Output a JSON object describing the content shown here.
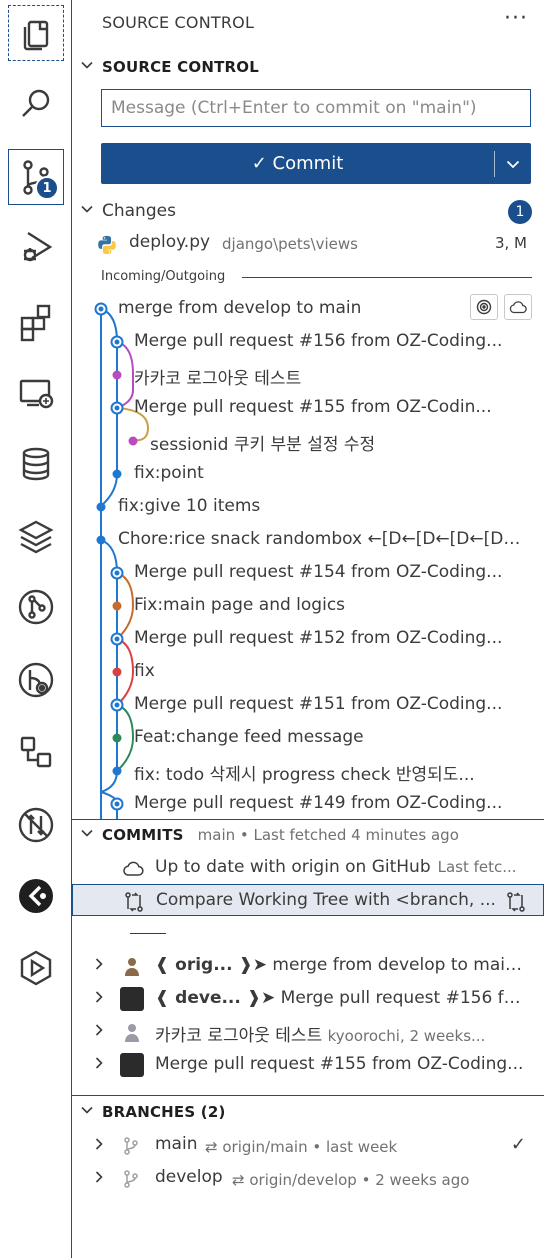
{
  "sidebar": {
    "title": "SOURCE CONTROL",
    "more": "···"
  },
  "activity": {
    "items": [
      {
        "icon": "explorer-icon"
      },
      {
        "icon": "search-icon"
      },
      {
        "icon": "source-control-icon",
        "badge": "1"
      },
      {
        "icon": "run-debug-icon"
      },
      {
        "icon": "extensions-icon"
      },
      {
        "icon": "remote-explorer-icon"
      },
      {
        "icon": "database-icon"
      },
      {
        "icon": "layers-icon"
      },
      {
        "icon": "git-graph-icon"
      },
      {
        "icon": "git-lens-icon"
      },
      {
        "icon": "workflow-icon"
      },
      {
        "icon": "no-sync-icon"
      },
      {
        "icon": "live-share-icon"
      },
      {
        "icon": "container-icon"
      }
    ]
  },
  "scm": {
    "section_title": "SOURCE CONTROL",
    "message_placeholder": "Message (Ctrl+Enter to commit on \"main\")",
    "commit_label": "✓ Commit",
    "changes_label": "Changes",
    "changes_count": "1",
    "file": {
      "name": "deploy.py",
      "dir": "django\\pets\\views",
      "status": "3, M"
    },
    "incoming_outgoing_label": "Incoming/Outgoing",
    "graph": [
      {
        "text": "merge from develop to main",
        "color": "#1f77d0",
        "lane": 0
      },
      {
        "text": "Merge pull request #156 from OZ-Coding...",
        "color": "#1f77d0",
        "lane": 1
      },
      {
        "text": "카카코 로그아웃 테스트",
        "color": "#b84cbf",
        "lane": 1
      },
      {
        "text": "Merge pull request #155 from OZ-Codin...",
        "color": "#1f77d0",
        "lane": 1
      },
      {
        "text": "sessionid 쿠키 부분 설정 수정",
        "color": "#b84cbf",
        "lane": 2
      },
      {
        "text": "fix:point",
        "color": "#1f77d0",
        "lane": 1
      },
      {
        "text": "fix:give 10 items",
        "color": "#1f77d0",
        "lane": 0
      },
      {
        "text": "Chore:rice snack randombox ←[D←[D←[D←[D←...",
        "color": "#1f77d0",
        "lane": 0
      },
      {
        "text": "Merge pull request #154 from OZ-Coding...",
        "color": "#1f77d0",
        "lane": 1
      },
      {
        "text": "Fix:main page and logics",
        "color": "#c96a2a",
        "lane": 1
      },
      {
        "text": "Merge pull request #152 from OZ-Coding...",
        "color": "#1f77d0",
        "lane": 1
      },
      {
        "text": "fix",
        "color": "#d94040",
        "lane": 1
      },
      {
        "text": "Merge pull request #151 from OZ-Coding...",
        "color": "#1f77d0",
        "lane": 1
      },
      {
        "text": "Feat:change feed message",
        "color": "#2c8a5a",
        "lane": 1
      },
      {
        "text": "fix: todo 삭제시 progress check 반영되도...",
        "color": "#1f77d0",
        "lane": 1
      },
      {
        "text": "Merge pull request #149 from OZ-Coding...",
        "color": "#1f77d0",
        "lane": 1
      }
    ]
  },
  "commits": {
    "section_title": "COMMITS",
    "description": "main • Last fetched 4 minutes ago",
    "status_text": "Up to date with origin on GitHub",
    "status_desc": "Last fetc...",
    "compare_text": "Compare Working Tree with <branch, ...",
    "history": [
      {
        "pill": "❰ orig... ❱➤",
        "text": "merge from develop to main...",
        "desc": ""
      },
      {
        "pill": "❰ deve... ❱➤",
        "text": "Merge pull request #156 fro...",
        "desc": ""
      },
      {
        "pill": "",
        "text": "카카코 로그아웃 테스트",
        "desc": "kyoorochi, 2 weeks..."
      },
      {
        "pill": "",
        "text": "Merge pull request #155 from OZ-Coding...",
        "desc": ""
      }
    ]
  },
  "branches": {
    "section_title": "BRANCHES (2)",
    "items": [
      {
        "name": "main",
        "upstream": "origin/main",
        "when": "last week",
        "current": true
      },
      {
        "name": "develop",
        "upstream": "origin/develop",
        "when": "2 weeks ago",
        "current": false
      }
    ]
  },
  "colors": {
    "accent": "#1a4e8c",
    "lane_blue": "#1f77d0",
    "lane_purple": "#b84cbf"
  }
}
